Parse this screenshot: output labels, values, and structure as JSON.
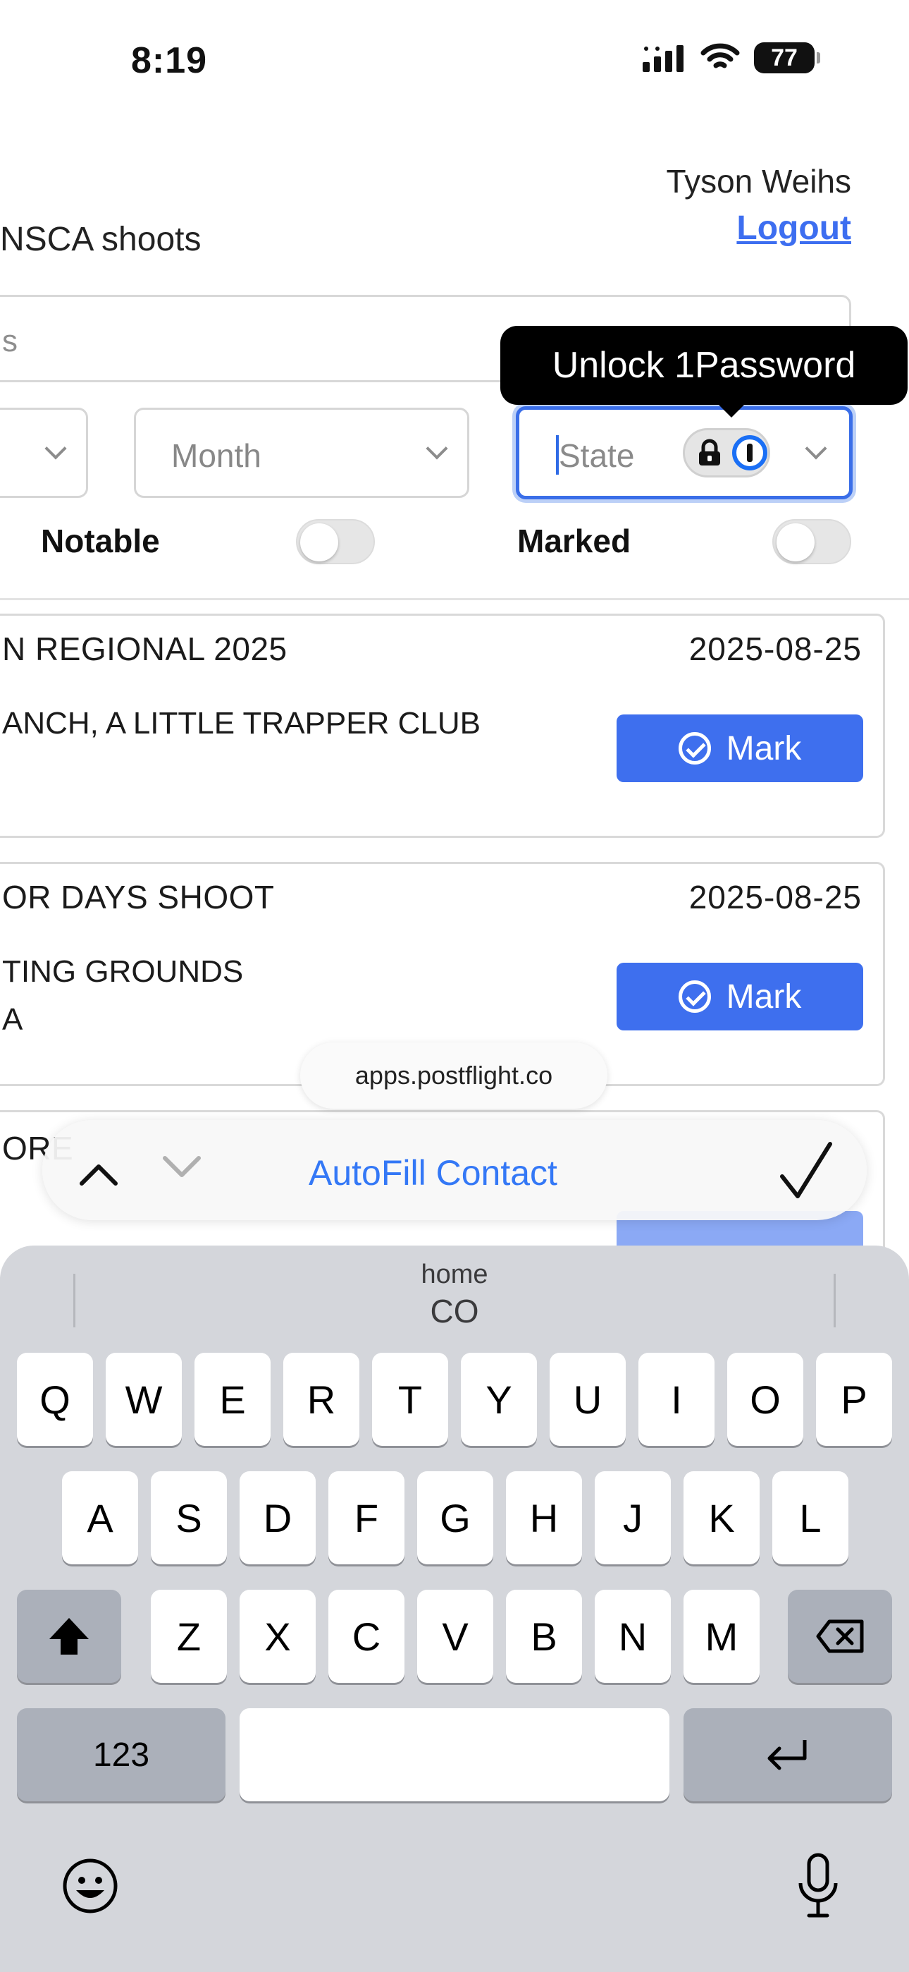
{
  "status_bar": {
    "time": "8:19",
    "battery": "77"
  },
  "header": {
    "user_name": "Tyson Weihs",
    "logout": "Logout",
    "page_title": "NSCA shoots"
  },
  "search": {
    "placeholder": "s"
  },
  "filters": {
    "select1_value": "",
    "month_placeholder": "Month",
    "state_placeholder": "State",
    "notable_label": "Notable",
    "marked_label": "Marked",
    "notable_on": false,
    "marked_on": false
  },
  "tooltip": {
    "text": "Unlock 1Password"
  },
  "results": [
    {
      "title": "N REGIONAL 2025",
      "date": "2025-08-25",
      "line1": "ANCH, A LITTLE TRAPPER CLUB",
      "line2": "",
      "mark_label": "Mark"
    },
    {
      "title": "OR DAYS SHOOT",
      "date": "2025-08-25",
      "line1": "TING GROUNDS",
      "line2": "A",
      "mark_label": "Mark"
    },
    {
      "title": "ORE",
      "date": "",
      "line1": "",
      "line2": "",
      "mark_label": ""
    }
  ],
  "browser": {
    "domain": "apps.postflight.co"
  },
  "autofill": {
    "label": "AutoFill Contact"
  },
  "keyboard": {
    "suggestion_label": "home",
    "suggestion_value": "CO",
    "row1": [
      "Q",
      "W",
      "E",
      "R",
      "T",
      "Y",
      "U",
      "I",
      "O",
      "P"
    ],
    "row2": [
      "A",
      "S",
      "D",
      "F",
      "G",
      "H",
      "J",
      "K",
      "L"
    ],
    "row3": [
      "Z",
      "X",
      "C",
      "V",
      "B",
      "N",
      "M"
    ],
    "numbers_key": "123"
  },
  "colors": {
    "accent": "#3e6fee",
    "link": "#3d6ef0",
    "focus": "#3a6ee8",
    "autofill": "#3478f6"
  }
}
